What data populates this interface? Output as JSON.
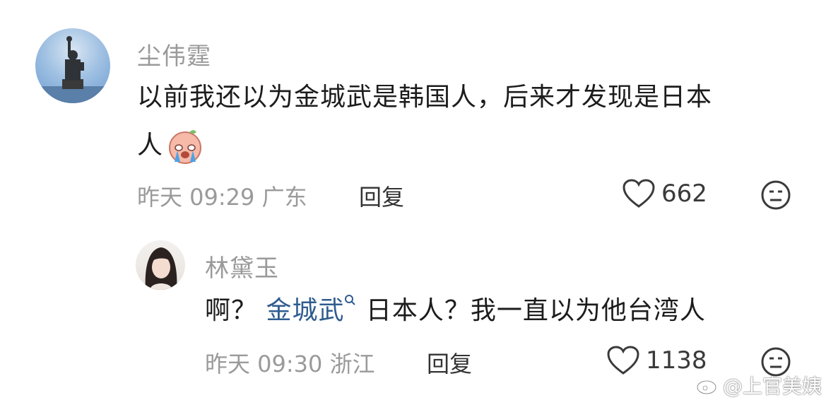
{
  "comments": [
    {
      "username": "尘伟霆",
      "text_line1": "以前我还以为金城武是韩国人，后来才发现是日本",
      "text_line2": "人",
      "emoji": "crying-face-emoji",
      "time": "昨天 09:29 广东",
      "reply_label": "回复",
      "likes": "662",
      "avatar": "statue-of-liberty-avatar"
    },
    {
      "username": "林黛玉",
      "text_before": "啊？ ",
      "mention": "金城武",
      "text_after": " 日本人？我一直以为他台湾人",
      "time": "昨天 09:30 浙江",
      "reply_label": "回复",
      "likes": "1138",
      "avatar": "girl-portrait-avatar"
    }
  ],
  "watermark": "@上官美姨",
  "colors": {
    "mention": "#2f5c8f",
    "meta": "#9a9a9a",
    "text": "#1c1c1c"
  }
}
